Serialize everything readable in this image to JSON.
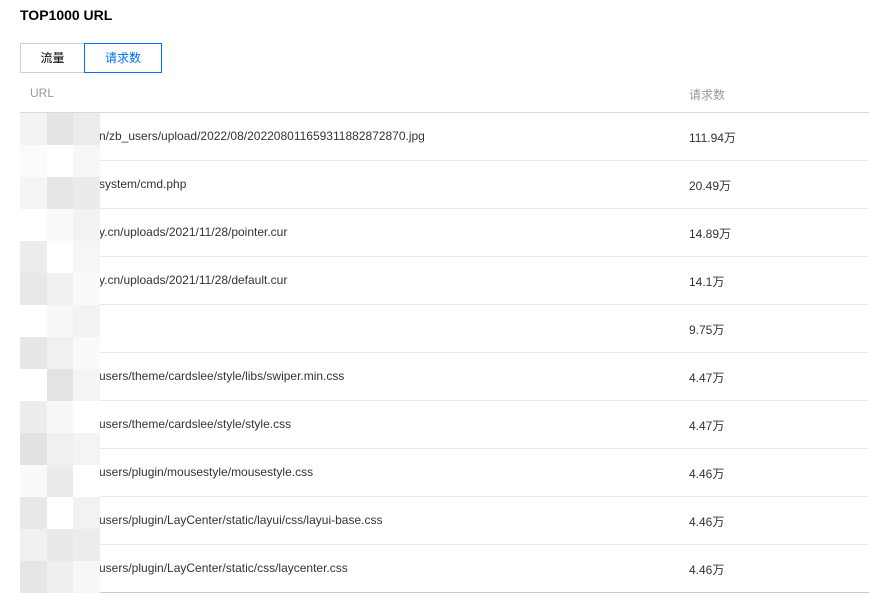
{
  "title": "TOP1000 URL",
  "tabs": [
    {
      "label": "流量",
      "active": false
    },
    {
      "label": "请求数",
      "active": true
    }
  ],
  "table": {
    "columns": {
      "url": "URL",
      "count": "请求数"
    },
    "rows": [
      {
        "url": "n/zb_users/upload/2022/08/202208011659311882872870.jpg",
        "count": "111.94万"
      },
      {
        "url": "system/cmd.php",
        "count": "20.49万"
      },
      {
        "url": "y.cn/uploads/2021/11/28/pointer.cur",
        "count": "14.89万"
      },
      {
        "url": "y.cn/uploads/2021/11/28/default.cur",
        "count": "14.1万"
      },
      {
        "url": "",
        "count": "9.75万"
      },
      {
        "url": "users/theme/cardslee/style/libs/swiper.min.css",
        "count": "4.47万"
      },
      {
        "url": "users/theme/cardslee/style/style.css",
        "count": "4.47万"
      },
      {
        "url": "users/plugin/mousestyle/mousestyle.css",
        "count": "4.46万"
      },
      {
        "url": "users/plugin/LayCenter/static/layui/css/layui-base.css",
        "count": "4.46万"
      },
      {
        "url": "users/plugin/LayCenter/static/css/laycenter.css",
        "count": "4.46万"
      }
    ]
  },
  "colors": {
    "accent": "#006eff",
    "header_text": "#999999",
    "body_text": "#333333"
  }
}
